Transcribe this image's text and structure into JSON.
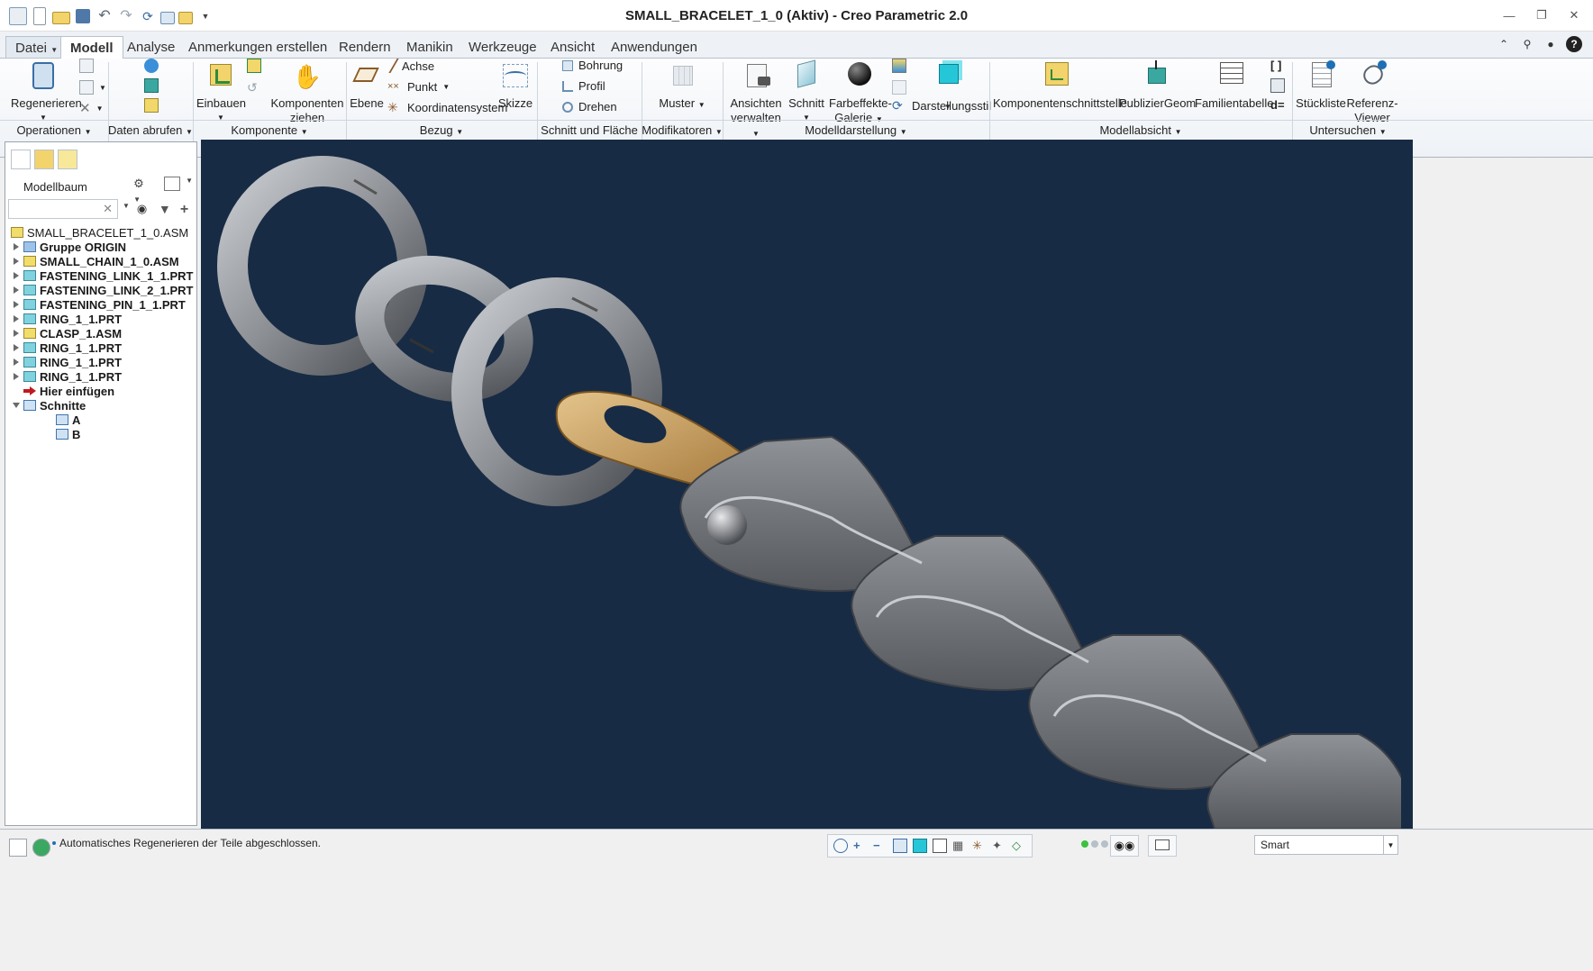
{
  "window": {
    "title": "SMALL_BRACELET_1_0 (Aktiv) - Creo Parametric 2.0",
    "controls": [
      "minimize",
      "restore",
      "close"
    ]
  },
  "ribbon_tabs": [
    "Datei",
    "Modell",
    "Analyse",
    "Anmerkungen erstellen",
    "Rendern",
    "Manikin",
    "Werkzeuge",
    "Ansicht",
    "Anwendungen"
  ],
  "active_tab": "Modell",
  "ribbon": {
    "regenerieren": "Regenerieren",
    "einbauen": "Einbauen",
    "komponenten_ziehen_1": "Komponenten",
    "komponenten_ziehen_2": "ziehen",
    "ebene": "Ebene",
    "achse": "Achse",
    "punkt": "Punkt",
    "koordinatensystem": "Koordinatensystem",
    "skizze": "Skizze",
    "bohrung": "Bohrung",
    "profil": "Profil",
    "drehen": "Drehen",
    "muster": "Muster",
    "ansichten_1": "Ansichten",
    "ansichten_2": "verwalten",
    "schnitt": "Schnitt",
    "farbeffekte_1": "Farbeffekte-",
    "farbeffekte_2": "Galerie",
    "darstellungsstil": "Darstellungsstil",
    "komponentenschnittstelle": "Komponentenschnittstelle",
    "publiziergeom": "PublizierGeom",
    "familientabelle": "Familientabelle",
    "stueckliste": "Stückliste",
    "referenz_1": "Referenz-",
    "referenz_2": "Viewer"
  },
  "groups": [
    "Operationen",
    "Daten abrufen",
    "Komponente",
    "Bezug",
    "Schnitt und Fläche",
    "Modifikatoren",
    "Modelldarstellung",
    "Modellabsicht",
    "Untersuchen"
  ],
  "model_tree": {
    "title": "Modellbaum",
    "search_value": "",
    "items": [
      {
        "label": "SMALL_BRACELET_1_0.ASM",
        "type": "asm",
        "expander": "none",
        "indent": 0
      },
      {
        "label": "Gruppe ORIGIN",
        "type": "grp",
        "expander": "right",
        "indent": 1
      },
      {
        "label": "SMALL_CHAIN_1_0.ASM",
        "type": "asm",
        "expander": "right",
        "indent": 1
      },
      {
        "label": "FASTENING_LINK_1_1.PRT",
        "type": "prt",
        "expander": "right",
        "indent": 1
      },
      {
        "label": "FASTENING_LINK_2_1.PRT",
        "type": "prt",
        "expander": "right",
        "indent": 1
      },
      {
        "label": "FASTENING_PIN_1_1.PRT",
        "type": "prt",
        "expander": "right",
        "indent": 1
      },
      {
        "label": "RING_1_1.PRT",
        "type": "prt",
        "expander": "right",
        "indent": 1
      },
      {
        "label": "CLASP_1.ASM",
        "type": "asm",
        "expander": "right",
        "indent": 1
      },
      {
        "label": "RING_1_1.PRT",
        "type": "prt",
        "expander": "right",
        "indent": 1
      },
      {
        "label": "RING_1_1.PRT",
        "type": "prt",
        "expander": "right",
        "indent": 1
      },
      {
        "label": "RING_1_1.PRT",
        "type": "prt",
        "expander": "right",
        "indent": 1
      },
      {
        "label": "Hier einfügen",
        "type": "ins",
        "expander": "none",
        "indent": 1
      },
      {
        "label": "Schnitte",
        "type": "sec",
        "expander": "down",
        "indent": 1
      },
      {
        "label": "A",
        "type": "sec",
        "expander": "none",
        "indent": 2
      },
      {
        "label": "B",
        "type": "sec",
        "expander": "none",
        "indent": 2
      }
    ]
  },
  "status": {
    "message": "Automatisches Regenerieren der Teile abgeschlossen.",
    "filter": "Smart"
  },
  "colors": {
    "viewport_bg": "#182b44",
    "metal": "#8e9196",
    "gold": "#c9a060",
    "accent": "#3a6ea5"
  }
}
